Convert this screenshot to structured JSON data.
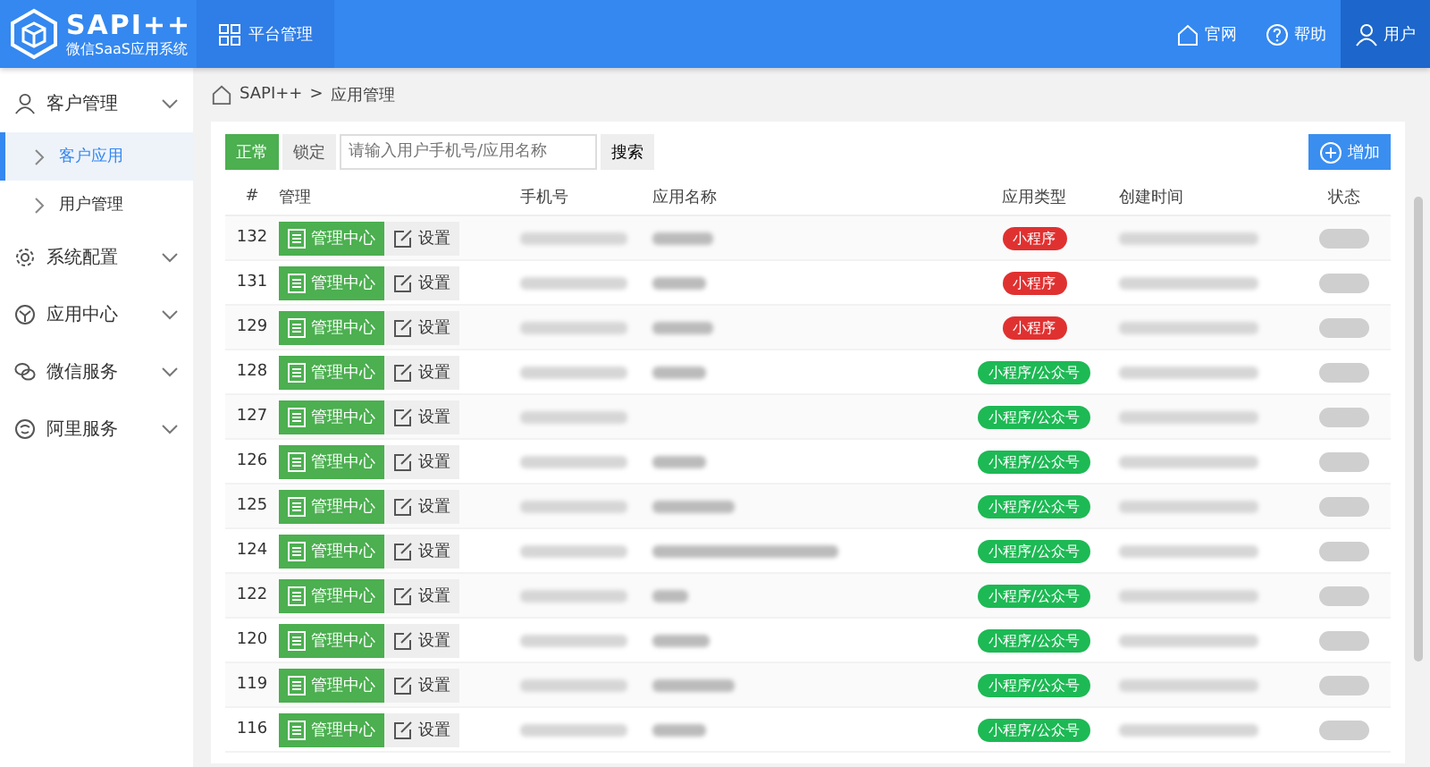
{
  "header": {
    "logo_title": "SAPI++",
    "logo_subtitle": "微信SaaS应用系统",
    "nav_tab": "平台管理",
    "links": [
      {
        "kind": "home",
        "label": "官网",
        "selected": false
      },
      {
        "kind": "help",
        "label": "帮助",
        "selected": false
      },
      {
        "kind": "user",
        "label": "用户",
        "selected": true
      }
    ]
  },
  "sidebar": {
    "items": [
      {
        "kind": "user",
        "label": "客户管理",
        "children": [
          {
            "label": "客户应用",
            "selected": true
          },
          {
            "label": "用户管理",
            "selected": false
          }
        ]
      },
      {
        "kind": "gear",
        "label": "系统配置"
      },
      {
        "kind": "app",
        "label": "应用中心"
      },
      {
        "kind": "wechat",
        "label": "微信服务"
      },
      {
        "kind": "ali",
        "label": "阿里服务"
      }
    ]
  },
  "breadcrumb": {
    "items": [
      "SAPI++",
      "应用管理"
    ],
    "separator": ">"
  },
  "toolbar": {
    "filters": [
      {
        "label": "正常",
        "selected": true
      },
      {
        "label": "锁定",
        "selected": false
      }
    ],
    "search": {
      "placeholder": "请输入用户手机号/应用名称"
    },
    "search_button": "搜索",
    "add_button": "增加"
  },
  "table": {
    "columns": [
      "#",
      "管理",
      "手机号",
      "应用名称",
      "应用类型",
      "创建时间",
      "状态"
    ],
    "rows": [
      {
        "id": "132",
        "manage": "管理中心",
        "settings": "设置",
        "name_shown": true,
        "app_type": {
          "label": "小程序",
          "color": "#e03131"
        }
      },
      {
        "id": "131",
        "manage": "管理中心",
        "settings": "设置",
        "name_shown": true,
        "app_type": {
          "label": "小程序",
          "color": "#e03131"
        }
      },
      {
        "id": "129",
        "manage": "管理中心",
        "settings": "设置",
        "name_shown": true,
        "app_type": {
          "label": "小程序",
          "color": "#e03131"
        }
      },
      {
        "id": "128",
        "manage": "管理中心",
        "settings": "设置",
        "name_shown": true,
        "app_type": {
          "label": "小程序/公众号",
          "color": "#1db954"
        }
      },
      {
        "id": "127",
        "manage": "管理中心",
        "settings": "设置",
        "name_shown": false,
        "app_type": {
          "label": "小程序/公众号",
          "color": "#1db954"
        }
      },
      {
        "id": "126",
        "manage": "管理中心",
        "settings": "设置",
        "name_shown": true,
        "app_type": {
          "label": "小程序/公众号",
          "color": "#1db954"
        }
      },
      {
        "id": "125",
        "manage": "管理中心",
        "settings": "设置",
        "name_shown": true,
        "app_type": {
          "label": "小程序/公众号",
          "color": "#1db954"
        }
      },
      {
        "id": "124",
        "manage": "管理中心",
        "settings": "设置",
        "name_shown": true,
        "app_type": {
          "label": "小程序/公众号",
          "color": "#1db954"
        }
      },
      {
        "id": "122",
        "manage": "管理中心",
        "settings": "设置",
        "name_shown": true,
        "app_type": {
          "label": "小程序/公众号",
          "color": "#1db954"
        }
      },
      {
        "id": "120",
        "manage": "管理中心",
        "settings": "设置",
        "name_shown": true,
        "app_type": {
          "label": "小程序/公众号",
          "color": "#1db954"
        }
      },
      {
        "id": "119",
        "manage": "管理中心",
        "settings": "设置",
        "name_shown": true,
        "app_type": {
          "label": "小程序/公众号",
          "color": "#1db954"
        }
      },
      {
        "id": "116",
        "manage": "管理中心",
        "settings": "设置",
        "name_shown": true,
        "app_type": {
          "label": "小程序/公众号",
          "color": "#1db954"
        }
      }
    ]
  }
}
